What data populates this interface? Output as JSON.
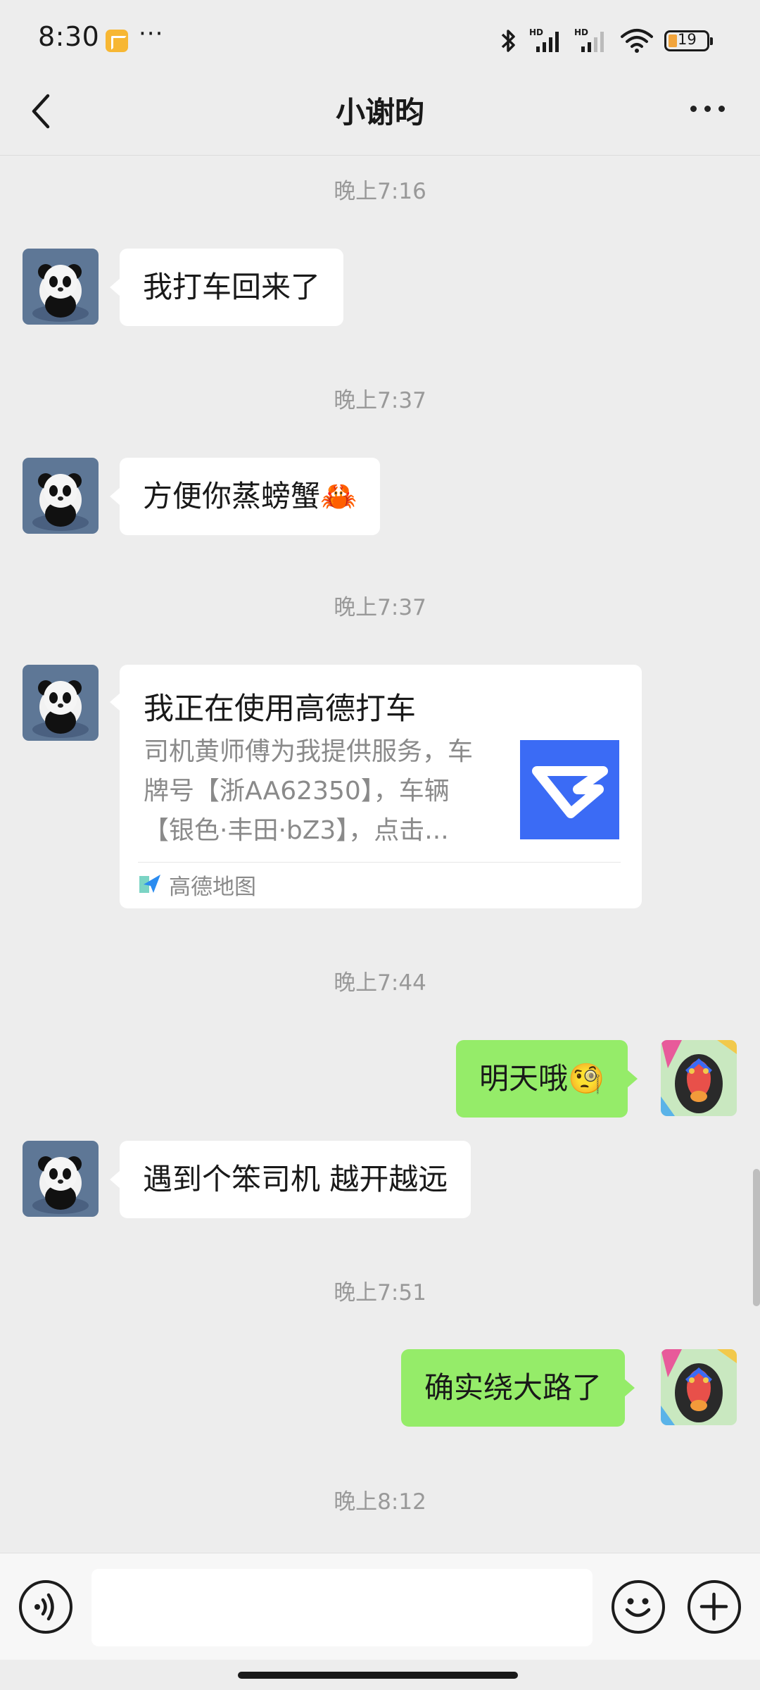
{
  "status_bar": {
    "time": "8:30",
    "overflow": "···",
    "icons": [
      "bluetooth-icon",
      "signal-hd-icon",
      "signal-hd-icon",
      "wifi-icon",
      "battery-icon"
    ],
    "battery": "19"
  },
  "header": {
    "title": "小谢昀",
    "back_icon": "chevron-left-icon",
    "more_icon": "more-dots-icon"
  },
  "messages": [
    {
      "type": "timestamp",
      "text": "晚上7:16"
    },
    {
      "type": "text",
      "side": "left",
      "text": "我打车回来了"
    },
    {
      "type": "timestamp",
      "text": "晚上7:37"
    },
    {
      "type": "text",
      "side": "left",
      "text": "方便你蒸螃蟹🦀"
    },
    {
      "type": "timestamp",
      "text": "晚上7:37"
    },
    {
      "type": "card",
      "side": "left",
      "title": "我正在使用高德打车",
      "desc_lines": [
        "司机黄师傅为我提供服务，车",
        "牌号【浙AA62350】，车辆",
        "【银色·丰田·bZ3】，点击..."
      ],
      "source": "高德地图"
    },
    {
      "type": "timestamp",
      "text": "晚上7:44"
    },
    {
      "type": "text",
      "side": "right",
      "text": "明天哦🧐"
    },
    {
      "type": "text",
      "side": "left",
      "text": "遇到个笨司机 越开越远"
    },
    {
      "type": "timestamp",
      "text": "晚上7:51"
    },
    {
      "type": "text",
      "side": "right",
      "text": "确实绕大路了"
    },
    {
      "type": "timestamp",
      "text": "晚上8:12"
    }
  ],
  "input_bar": {
    "voice_icon": "voice-icon",
    "emoji_icon": "emoji-icon",
    "plus_icon": "plus-icon",
    "value": ""
  },
  "colors": {
    "background": "#EDEDED",
    "bubble_self": "#95EC69",
    "bubble_other": "#FFFFFF",
    "timestamp": "#999999",
    "card_thumb": "#3B6BF5"
  }
}
